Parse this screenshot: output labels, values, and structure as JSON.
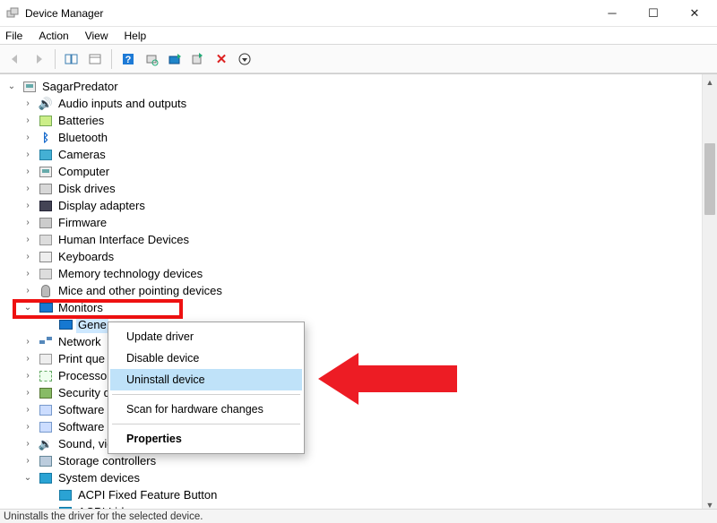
{
  "window": {
    "title": "Device Manager"
  },
  "menu": {
    "file": "File",
    "action": "Action",
    "view": "View",
    "help": "Help"
  },
  "tree": {
    "root": "SagarPredator",
    "audio": "Audio inputs and outputs",
    "batteries": "Batteries",
    "bluetooth": "Bluetooth",
    "cameras": "Cameras",
    "computer": "Computer",
    "disk": "Disk drives",
    "display": "Display adapters",
    "firmware": "Firmware",
    "hid": "Human Interface Devices",
    "keyboards": "Keyboards",
    "memtech": "Memory technology devices",
    "mice": "Mice and other pointing devices",
    "monitors": "Monitors",
    "generic_pnp": "Gene",
    "network": "Network",
    "printq": "Print que",
    "processors": "Processo",
    "security": "Security d",
    "software1": "Software c",
    "software2": "Software d",
    "sound": "Sound, video and game controllers",
    "storage": "Storage controllers",
    "sysdev": "System devices",
    "acpi_ffb": "ACPI Fixed Feature Button",
    "acpi_lid": "ACPI Lid"
  },
  "context_menu": {
    "update": "Update driver",
    "disable": "Disable device",
    "uninstall": "Uninstall device",
    "scan": "Scan for hardware changes",
    "properties": "Properties"
  },
  "status": "Uninstalls the driver for the selected device."
}
